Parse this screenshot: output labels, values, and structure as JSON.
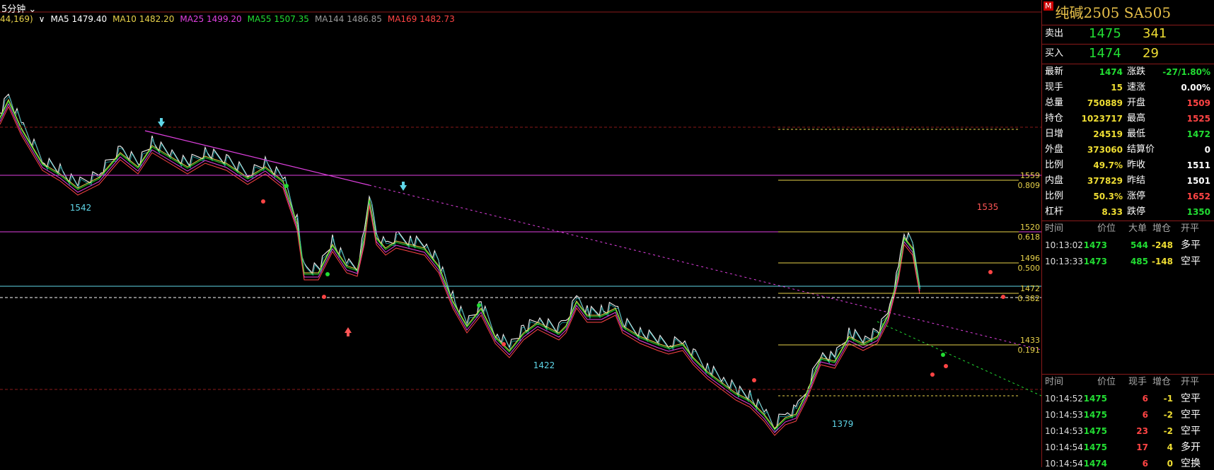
{
  "timeframe": {
    "label": "5分钟",
    "icon": "chevron-down-icon"
  },
  "ma_legend": [
    {
      "text": "44,169)",
      "color": "#e8d24a"
    },
    {
      "text": "∨",
      "color": "#ffffff"
    },
    {
      "text": "MA5 1479.40",
      "color": "#ffffff"
    },
    {
      "text": "MA10 1482.20",
      "color": "#e8d24a"
    },
    {
      "text": "MA25 1499.20",
      "color": "#e040e0"
    },
    {
      "text": "MA55 1507.35",
      "color": "#22dd33"
    },
    {
      "text": "MA144 1486.85",
      "color": "#999999"
    },
    {
      "text": "MA169 1482.73",
      "color": "#ff4444"
    }
  ],
  "chart_labels": {
    "low1": "1542",
    "low2": "1422",
    "low3": "1379",
    "high": "1535"
  },
  "fib_levels": [
    {
      "price": "1559",
      "ratio": "0.809"
    },
    {
      "price": "1520",
      "ratio": "0.618"
    },
    {
      "price": "1496",
      "ratio": "0.500"
    },
    {
      "price": "1472",
      "ratio": "0.382"
    },
    {
      "price": "1433",
      "ratio": "0.191"
    }
  ],
  "panel": {
    "badge": "M",
    "title": "纯碱2505  SA505",
    "sell": {
      "label": "卖出",
      "price": "1475",
      "qty": "341"
    },
    "buy": {
      "label": "买入",
      "price": "1474",
      "qty": "29"
    },
    "stats": [
      {
        "l1": "最新",
        "v1": "1474",
        "c1": "g",
        "l2": "涨跌",
        "v2": "-27/1.80%",
        "c2": "g"
      },
      {
        "l1": "现手",
        "v1": "15",
        "c1": "y",
        "l2": "速涨",
        "v2": "0.00%",
        "c2": "w"
      },
      {
        "l1": "总量",
        "v1": "750889",
        "c1": "y",
        "l2": "开盘",
        "v2": "1509",
        "c2": "r"
      },
      {
        "l1": "持仓",
        "v1": "1023717",
        "c1": "y",
        "l2": "最高",
        "v2": "1525",
        "c2": "r"
      },
      {
        "l1": "日增",
        "v1": "24519",
        "c1": "y",
        "l2": "最低",
        "v2": "1472",
        "c2": "g"
      },
      {
        "l1": "外盘",
        "v1": "373060",
        "c1": "y",
        "l2": "结算价",
        "v2": "0",
        "c2": "w"
      },
      {
        "l1": "比例",
        "v1": "49.7%",
        "c1": "y",
        "l2": "昨收",
        "v2": "1511",
        "c2": "w"
      },
      {
        "l1": "内盘",
        "v1": "377829",
        "c1": "y",
        "l2": "昨结",
        "v2": "1501",
        "c2": "w"
      },
      {
        "l1": "比例",
        "v1": "50.3%",
        "c1": "y",
        "l2": "涨停",
        "v2": "1652",
        "c2": "r"
      },
      {
        "l1": "杠杆",
        "v1": "8.33",
        "c1": "y",
        "l2": "跌停",
        "v2": "1350",
        "c2": "g"
      }
    ],
    "bigtrade_headers": [
      "时间",
      "价位",
      "大单",
      "增仓",
      "开平"
    ],
    "bigtrades": [
      {
        "time": "10:13:02",
        "price": "1473",
        "size": "544",
        "inc": "-248",
        "type": "多平"
      },
      {
        "time": "10:13:33",
        "price": "1473",
        "size": "485",
        "inc": "-148",
        "type": "空平"
      }
    ],
    "tick_headers": [
      "时间",
      "价位",
      "现手",
      "增仓",
      "开平"
    ],
    "ticks": [
      {
        "time": "10:14:52",
        "price": "1475",
        "size": "6",
        "inc": "-1",
        "type": "空平"
      },
      {
        "time": "10:14:53",
        "price": "1475",
        "size": "6",
        "inc": "-2",
        "type": "空平"
      },
      {
        "time": "10:14:53",
        "price": "1475",
        "size": "23",
        "inc": "-2",
        "type": "空平"
      },
      {
        "time": "10:14:54",
        "price": "1475",
        "size": "17",
        "inc": "4",
        "type": "多开"
      },
      {
        "time": "10:14:54",
        "price": "1474",
        "size": "6",
        "inc": "0",
        "type": "空换"
      }
    ]
  }
}
